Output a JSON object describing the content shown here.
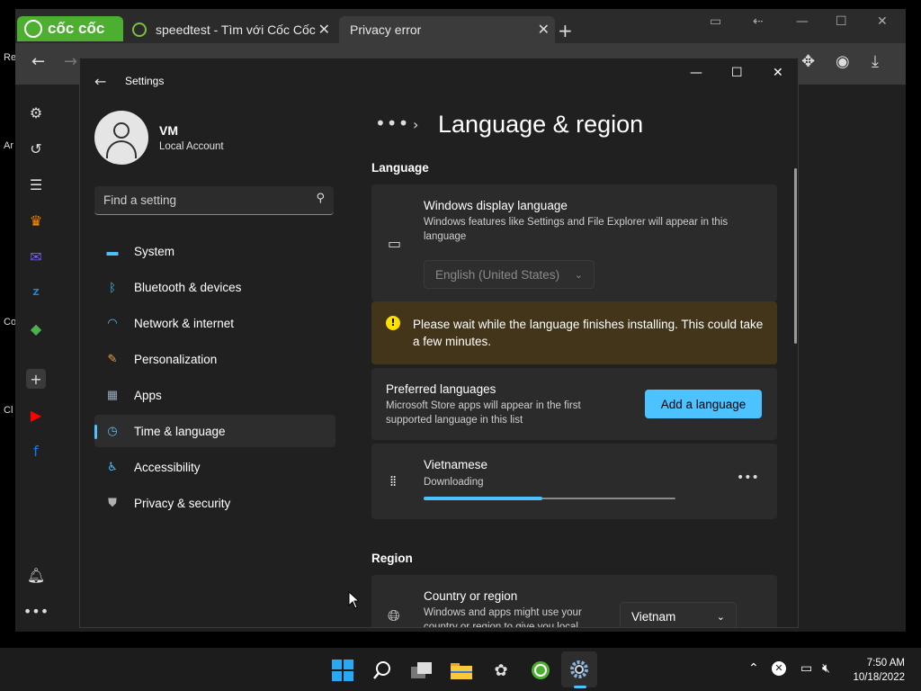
{
  "desktop": {
    "edge_labels": [
      "Re",
      "Ar",
      "Co",
      "Cl"
    ]
  },
  "browser": {
    "brand": "cốc cốc",
    "tabs": [
      {
        "title": "speedtest - Tìm với Cốc Cốc",
        "active": false
      },
      {
        "title": "Privacy error",
        "active": true
      }
    ]
  },
  "settings": {
    "app_title": "Settings",
    "user": {
      "name": "VM",
      "account": "Local Account"
    },
    "search": {
      "placeholder": "Find a setting"
    },
    "nav": [
      {
        "label": "System",
        "icon": "monitor-icon"
      },
      {
        "label": "Bluetooth & devices",
        "icon": "bluetooth-icon"
      },
      {
        "label": "Network & internet",
        "icon": "wifi-icon"
      },
      {
        "label": "Personalization",
        "icon": "brush-icon"
      },
      {
        "label": "Apps",
        "icon": "apps-icon"
      },
      {
        "label": "Time & language",
        "icon": "clock-globe-icon",
        "active": true
      },
      {
        "label": "Accessibility",
        "icon": "accessibility-icon"
      },
      {
        "label": "Privacy & security",
        "icon": "shield-icon"
      }
    ],
    "breadcrumb_overflow": "•••",
    "page_title": "Language & region",
    "language": {
      "section_title": "Language",
      "display_language": {
        "title": "Windows display language",
        "description": "Windows features like Settings and File Explorer will appear in this language",
        "value": "English (United States)"
      },
      "warning": "Please wait while the language finishes installing. This could take a few minutes.",
      "preferred": {
        "title": "Preferred languages",
        "description": "Microsoft Store apps will appear in the first supported language in this list",
        "button": "Add a language"
      },
      "installing": {
        "name": "Vietnamese",
        "status": "Downloading",
        "progress": 0.47
      }
    },
    "region": {
      "section_title": "Region",
      "country": {
        "title": "Country or region",
        "description": "Windows and apps might use your country or region to give you local",
        "value": "Vietnam"
      }
    }
  },
  "taskbar": {
    "time": "7:50 AM",
    "date": "10/18/2022"
  },
  "colors": {
    "accent": "#4cc2ff",
    "warning_bg": "#433519",
    "brand_green": "#4caf2f"
  }
}
